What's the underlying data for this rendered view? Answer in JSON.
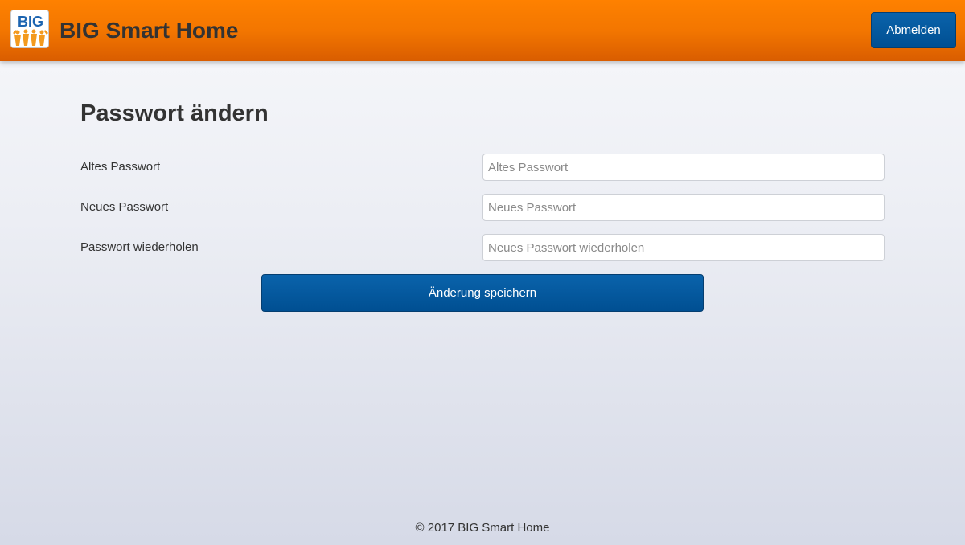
{
  "header": {
    "logo_icon": "big-logo-icon",
    "logo_text": "BIG",
    "title": "BIG Smart Home",
    "logout_label": "Abmelden"
  },
  "main": {
    "title": "Passwort ändern",
    "fields": [
      {
        "label": "Altes Passwort",
        "placeholder": "Altes Passwort",
        "value": ""
      },
      {
        "label": "Neues Passwort",
        "placeholder": "Neues Passwort",
        "value": ""
      },
      {
        "label": "Passwort wiederholen",
        "placeholder": "Neues Passwort wiederholen",
        "value": ""
      }
    ],
    "save_label": "Änderung speichern"
  },
  "footer": {
    "text": "© 2017 BIG Smart Home"
  },
  "colors": {
    "header_orange": "#f37600",
    "button_blue": "#004f92",
    "text": "#333333"
  }
}
